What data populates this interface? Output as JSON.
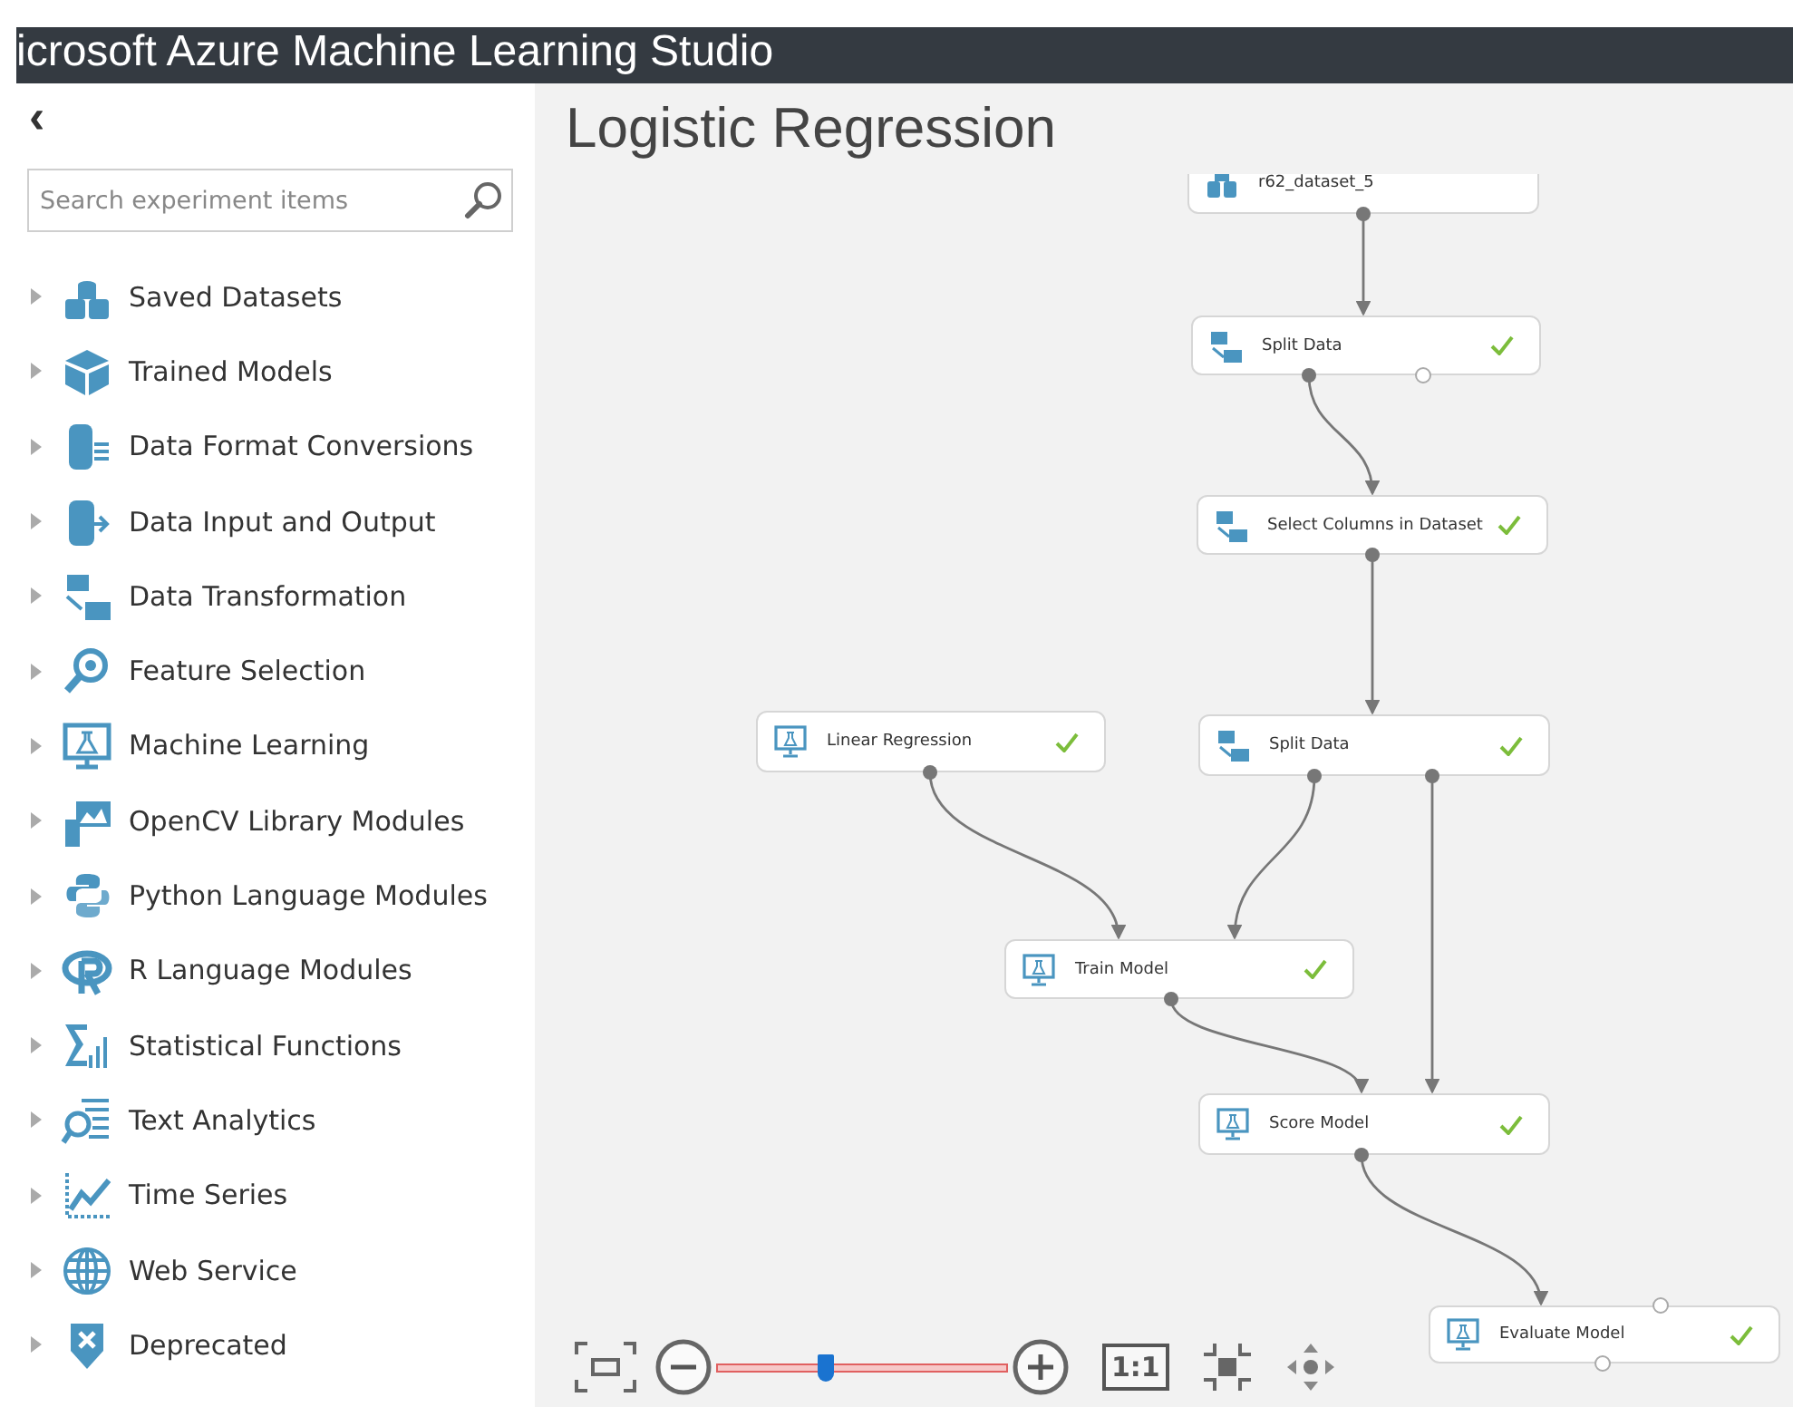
{
  "app_bar": {
    "title": "icrosoft Azure Machine Learning Studio"
  },
  "sidebar": {
    "collapse": "‹",
    "search": {
      "placeholder": "Search experiment items"
    },
    "items": [
      {
        "label": "Saved Datasets",
        "expanded": false
      },
      {
        "label": "Trained Models",
        "expanded": false
      },
      {
        "label": "Data Format Conversions",
        "expanded": false
      },
      {
        "label": "Data Input and Output",
        "expanded": false
      },
      {
        "label": "Data Transformation",
        "expanded": false
      },
      {
        "label": "Feature Selection",
        "expanded": false
      },
      {
        "label": "Machine Learning",
        "expanded": false
      },
      {
        "label": "OpenCV Library Modules",
        "expanded": false
      },
      {
        "label": "Python Language Modules",
        "expanded": false
      },
      {
        "label": "R Language Modules",
        "expanded": false
      },
      {
        "label": "Statistical Functions",
        "expanded": false
      },
      {
        "label": "Text Analytics",
        "expanded": false
      },
      {
        "label": "Time Series",
        "expanded": false
      },
      {
        "label": "Web Service",
        "expanded": false
      },
      {
        "label": "Deprecated",
        "expanded": false
      }
    ]
  },
  "experiment": {
    "title": "Logistic Regression",
    "nodes": [
      {
        "label": "r62_dataset_5",
        "kind": "dataset",
        "done": false
      },
      {
        "label": "Split Data",
        "kind": "transform",
        "done": true
      },
      {
        "label": "Select Columns in Dataset",
        "kind": "transform",
        "done": true
      },
      {
        "label": "Linear Regression",
        "kind": "model",
        "done": true
      },
      {
        "label": "Split Data",
        "kind": "transform",
        "done": true
      },
      {
        "label": "Train Model",
        "kind": "model",
        "done": true
      },
      {
        "label": "Score Model",
        "kind": "model",
        "done": true
      },
      {
        "label": "Evaluate Model",
        "kind": "model",
        "done": true
      }
    ]
  },
  "zoom": {
    "level": 0.37,
    "actual_size": "1:1"
  }
}
